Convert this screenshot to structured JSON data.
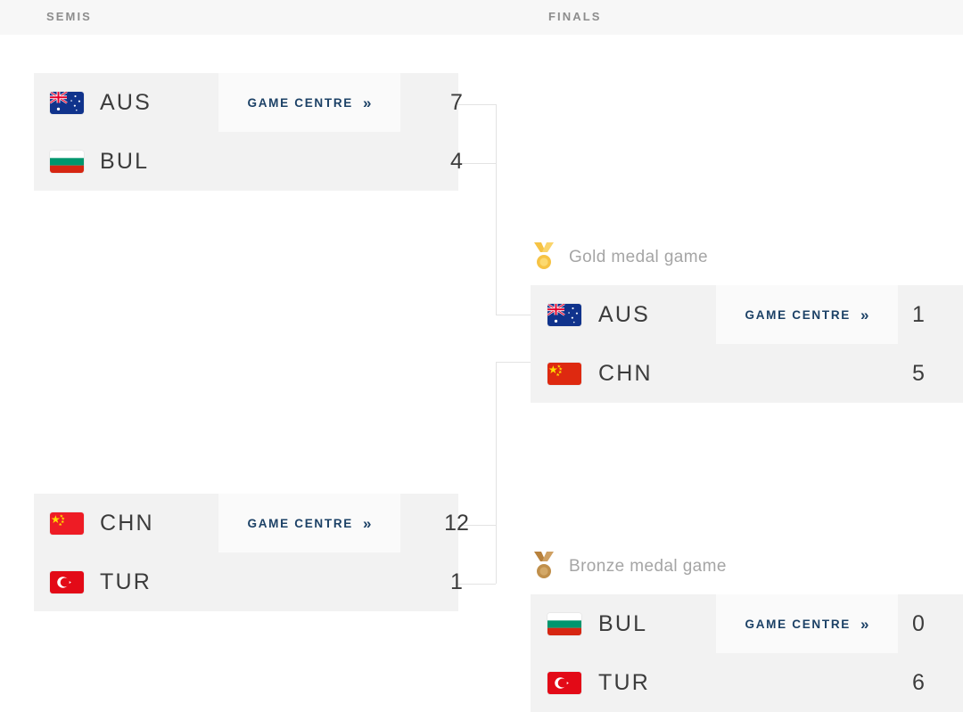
{
  "header": {
    "rounds": [
      {
        "label": "SEMIS"
      },
      {
        "label": "FINALS"
      }
    ]
  },
  "labels": {
    "game_centre": "GAME CENTRE",
    "chevron": "»"
  },
  "colors": {
    "page_background": "#ffffff",
    "header_background": "#f7f7f7",
    "match_background": "#f2f2f2",
    "game_centre_background": "#fafafa",
    "link_text": "#1c4166",
    "team_text": "#3c3c3c",
    "round_label_text": "#8d8d8d",
    "connector_line": "#e3e3e3",
    "gold_medal": "#f6c344",
    "bronze_medal": "#c08f4a"
  },
  "matches": {
    "semi1": {
      "round": "SEMIS",
      "teams": [
        {
          "code": "AUS",
          "flag": "flag-australia",
          "score": "7"
        },
        {
          "code": "BUL",
          "flag": "flag-bulgaria",
          "score": "4"
        }
      ]
    },
    "semi2": {
      "round": "SEMIS",
      "teams": [
        {
          "code": "CHN",
          "flag": "flag-china",
          "score": "12"
        },
        {
          "code": "TUR",
          "flag": "flag-turkey",
          "score": "1"
        }
      ]
    },
    "gold": {
      "round": "FINALS",
      "caption": "Gold medal game",
      "medal": "gold-medal-icon",
      "teams": [
        {
          "code": "AUS",
          "flag": "flag-australia",
          "score": "1"
        },
        {
          "code": "CHN",
          "flag": "flag-china",
          "score": "5"
        }
      ]
    },
    "bronze": {
      "round": "FINALS",
      "caption": "Bronze medal game",
      "medal": "bronze-medal-icon",
      "teams": [
        {
          "code": "BUL",
          "flag": "flag-bulgaria",
          "score": "0"
        },
        {
          "code": "TUR",
          "flag": "flag-turkey",
          "score": "6"
        }
      ]
    }
  }
}
